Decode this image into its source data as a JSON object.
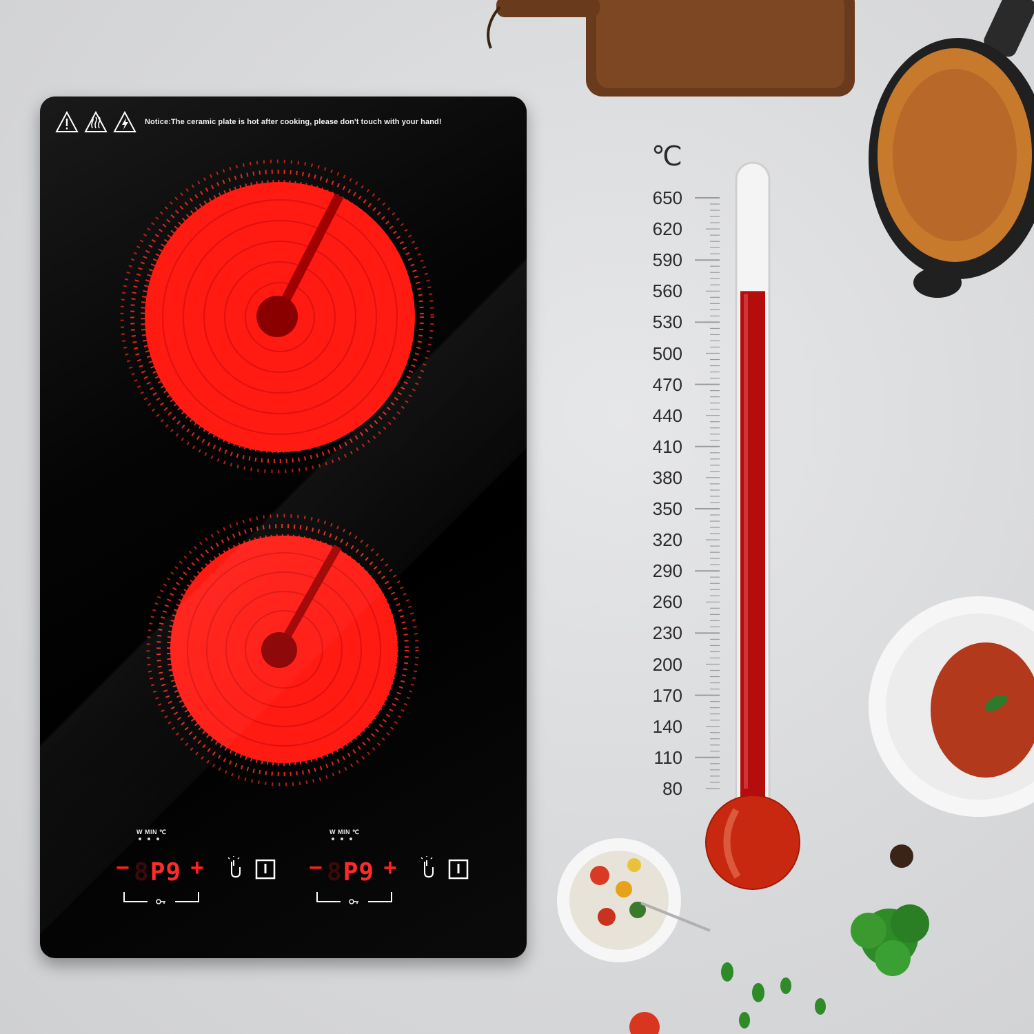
{
  "cooktop": {
    "notice": "Notice:The ceramic plate is hot after cooking, please don't touch with your hand!",
    "warning_icons": [
      "general-warning-icon",
      "hot-surface-icon",
      "electric-shock-icon"
    ],
    "burner_color": "#ff1a1a",
    "controls": [
      {
        "mode_labels": "W  MIN ℃",
        "minus": "−",
        "display_value": "P9",
        "plus": "+"
      },
      {
        "mode_labels": "W  MIN ℃",
        "minus": "−",
        "display_value": "P9",
        "plus": "+"
      }
    ]
  },
  "thermometer": {
    "unit": "℃",
    "scale": [
      "650",
      "620",
      "590",
      "560",
      "530",
      "500",
      "470",
      "440",
      "410",
      "380",
      "350",
      "320",
      "290",
      "260",
      "230",
      "200",
      "170",
      "140",
      "110",
      "80"
    ],
    "fill_level_value": 560,
    "fluid_color": "#b50d0d"
  }
}
